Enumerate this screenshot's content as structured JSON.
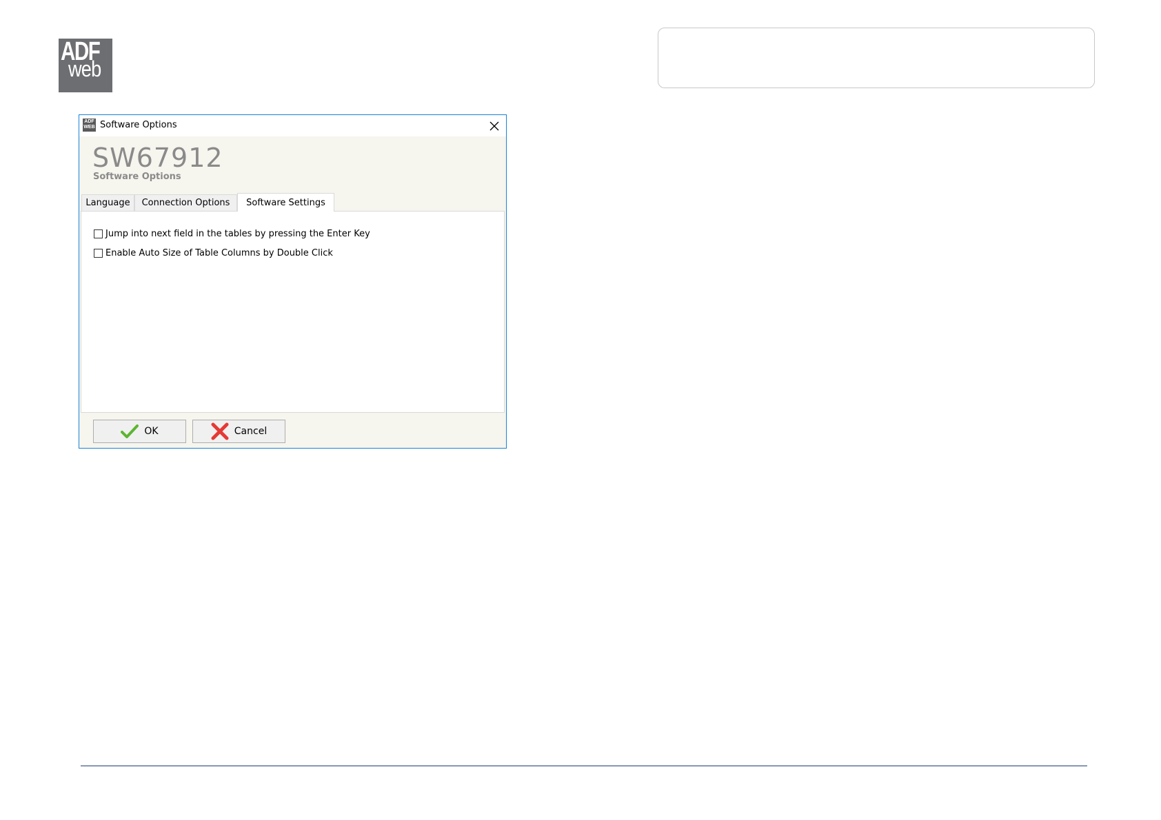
{
  "brand": {
    "logo_top": "ADF",
    "logo_bottom": "web"
  },
  "dialog": {
    "title": "Software Options",
    "app_code": "SW67912",
    "app_subtitle": "Software Options",
    "tabs": [
      {
        "label": "Language",
        "active": false
      },
      {
        "label": "Connection Options",
        "active": false
      },
      {
        "label": "Software Settings",
        "active": true
      }
    ],
    "options": [
      {
        "label": "Jump into next field in the tables by pressing the Enter Key",
        "checked": false
      },
      {
        "label": "Enable Auto Size of Table Columns by Double Click",
        "checked": false
      }
    ],
    "buttons": {
      "ok": "OK",
      "cancel": "Cancel"
    }
  },
  "colors": {
    "dialog_border": "#1883d7",
    "dialog_bg": "#f6f5ee",
    "logo_bg": "#6d6e71",
    "ok_icon": "#5cb531",
    "cancel_icon": "#e53935",
    "footer_rule": "#1f3d6e"
  },
  "icons": {
    "title_icon": "adfweb-app-icon",
    "close": "close-icon",
    "ok": "checkmark-icon",
    "cancel": "red-x-icon"
  }
}
